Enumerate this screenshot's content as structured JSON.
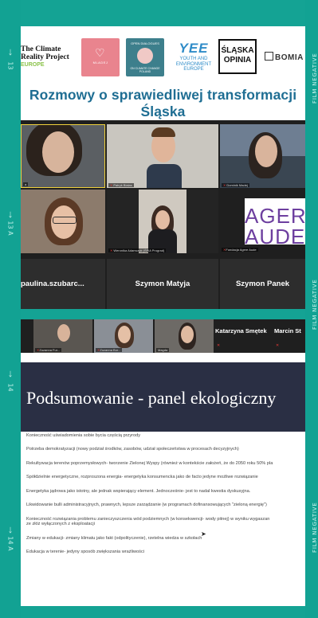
{
  "film": {
    "left_numbers": [
      "13",
      "13 A",
      "14",
      "14 A"
    ],
    "right_label": "FILM NEGATIVE"
  },
  "frame1": {
    "logos": {
      "climate_line1": "The Climate",
      "climate_line2": "Reality Project",
      "climate_sub": "EUROPE",
      "heart_text": "MLADEJ",
      "open_top": "OPEN DIALOGUES",
      "open_bottom": "ON CLIMATE CHANGE POLAND",
      "yee_big": "YEE",
      "yee_line1": "YOUTH AND",
      "yee_line2": "ENVIRONMENT",
      "yee_line3": "EUROPE",
      "opinia_line1": "ŚLĄSKA",
      "opinia_line2": "OPINIA",
      "bomia": "BOMIA"
    },
    "title": "Rozmowy o sprawiedliwej transformacji Śląska",
    "participants": [
      {
        "tag": "a"
      },
      {
        "tag": "Patryk Białas"
      },
      {
        "tag": "Dominik Madej"
      },
      {
        "tag": ""
      },
      {
        "tag": "Weronika Adamczyk (ŚPiA Prograd)"
      },
      {
        "tag": "Fundacja Agere Aude"
      }
    ],
    "agere_line1": "AGERE",
    "agere_line2": "AUDE",
    "names": [
      "paulina.szubarc...",
      "Szymon Matyja",
      "Szymon Panek"
    ]
  },
  "frame2": {
    "thumbs": [
      "Zuzanna Fur...",
      "Zuzanna Bor...",
      "Magda"
    ],
    "names": [
      "Katarzyna Smętek",
      "Marcin St"
    ],
    "slide_title": "Podsumowanie - panel ekologiczny",
    "bullets": [
      "Konieczność uświadomienia sobie bycia częścią przyrody",
      "Potrzeba demokratyzacji (nowy podział środków, zasobów, udział społeczeństwa w procesach decyzyjnych)",
      "Rekultywacja terenów poprzemysłowych- tworzenie Zielonej Wyspy (również w kontekście założeń, że do 2050 roku 50% pla",
      "Spółdzielnie energetyczne, rozproszona energia- energetyka konsumencka jako de facto jedyne możliwe rozwiązanie",
      "Energetyka jądrowa jako istotny, ale jednak wspierający element. Jednocześnie- jest to nadal kwestia dyskusyjna.",
      "Likwidowanie bulli administracyjnych, prawnych, lepsze zarządzanie (w programach dofinansowujących \"zieloną energię\")",
      "Konieczność rozwiązania problemu zanieczyszczenia wód podziemnych (w konsekwencji- wody pitnej) w wyniku wygaszan\nze złóż wyłączonych z eksploatacji",
      "Zmiany w edukacji- zmiany klimatu jako fakt (odpolityczenie), rzetelna wiedza w szkołach",
      "Edukacja w terenie- jedyny sposób zwiększania wrażliwości"
    ]
  }
}
